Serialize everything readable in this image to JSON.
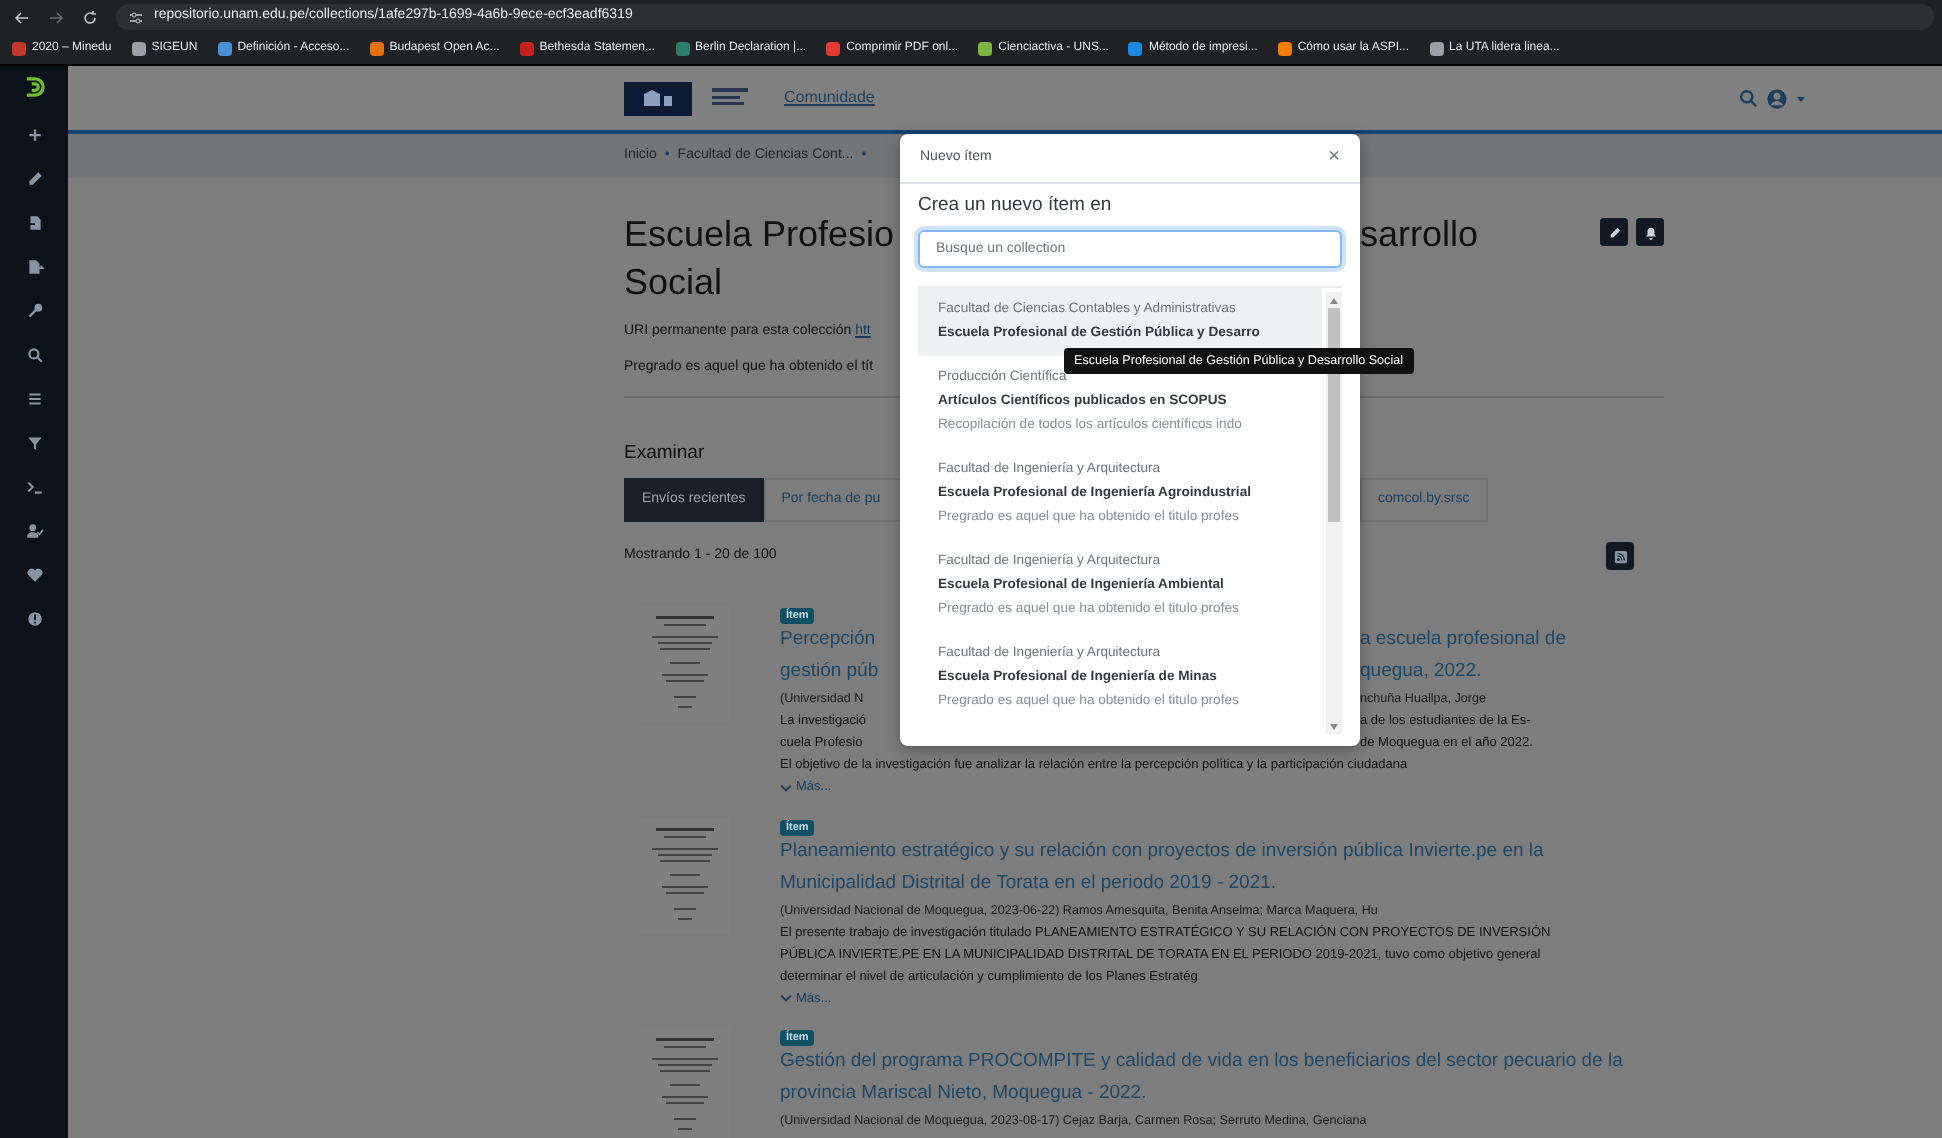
{
  "browser": {
    "url": "repositorio.unam.edu.pe/collections/1afe297b-1699-4a6b-9ece-ecf3eadf6319",
    "bookmarks": [
      {
        "label": "2020 – Minedu",
        "color": "#c0392b"
      },
      {
        "label": "SIGEUN",
        "color": "#9aa0a6"
      },
      {
        "label": "Definición - Acceso...",
        "color": "#4a90d9"
      },
      {
        "label": "Budapest Open Ac...",
        "color": "#e8710a"
      },
      {
        "label": "Bethesda Statemen...",
        "color": "#c5221f"
      },
      {
        "label": "Berlin Declaration |...",
        "color": "#2e7d6b"
      },
      {
        "label": "Comprimir PDF onl...",
        "color": "#e53935"
      },
      {
        "label": "Cienciactiva - UNS...",
        "color": "#7cb342"
      },
      {
        "label": "Método de impresi...",
        "color": "#1e88e5"
      },
      {
        "label": "Cómo usar la ASPI...",
        "color": "#f57c00"
      },
      {
        "label": "La UTA lidera linea...",
        "color": "#9aa0a6"
      }
    ]
  },
  "header": {
    "nav": [
      "Comunidade"
    ]
  },
  "breadcrumb": [
    {
      "kind": "link",
      "text": "Inicio"
    },
    {
      "kind": "separator",
      "text": "•"
    },
    {
      "kind": "link",
      "text": "Facultad de Ciencias Cont..."
    },
    {
      "kind": "separator",
      "text": "•"
    }
  ],
  "collection": {
    "title_left": "Escuela Profesio",
    "title_right": "sarrollo",
    "title_line2": "Social",
    "uri_label": "URI permanente para esta colección",
    "uri_link": "htt",
    "description": "Pregrado es aquel que ha obtenido el tít"
  },
  "browse": {
    "heading": "Examinar",
    "tabs": [
      {
        "label": "Envíos recientes",
        "selected": true
      },
      {
        "label": "Por fecha de pu",
        "selected": false
      },
      {
        "label": "comcol.by.srsc",
        "selected": false
      }
    ]
  },
  "results": {
    "summary": "Mostrando 1 - 20 de 100",
    "items": [
      {
        "badge": "Ítem",
        "lines": [
          {
            "kind": "title",
            "left": "Percepción",
            "right": "a escuela profesional de"
          },
          {
            "kind": "title",
            "left": "gestión púb",
            "right": "quegua, 2022."
          },
          {
            "kind": "meta",
            "left": "(Universidad N",
            "right": "nchuña Huallpa, Jorge"
          },
          {
            "kind": "abstract",
            "left": "La investigació",
            "right": "a de los estudiantes de la Es-"
          },
          {
            "kind": "abstract",
            "left": "cuela Profesio",
            "right": "de Moquegua en el año 2022."
          },
          {
            "kind": "abstract",
            "left": "El objetivo de la investigación fue analizar la relación entre la percepción política y la participación ciudadana"
          }
        ],
        "more": "Más..."
      },
      {
        "badge": "Ítem",
        "title": "Planeamiento estratégico y su relación con proyectos de inversión pública Invierte.pe en la Municipalidad Distrital de Torata en el periodo 2019 - 2021.",
        "meta": "(Universidad Nacional de Moquegua, 2023-06-22) Ramos Amesquita, Benita Anselma; Marca Maquera, Hu",
        "abstract": "El presente trabajo de investigación titulado PLANEAMIENTO ESTRATÉGICO Y SU RELACIÓN CON PROYECTOS DE INVERSIÓN PÚBLICA INVIERTE.PE EN LA MUNICIPALIDAD DISTRITAL DE TORATA EN EL PERIODO 2019-2021, tuvo como objetivo general determinar el nivel de articulación y cumplimiento de los Planes Estratég",
        "more": "Más..."
      },
      {
        "badge": "Ítem",
        "title": "Gestión del programa PROCOMPITE y calidad de vida en los beneficiarios del sector pecuario de la provincia Mariscal Nieto, Moquegua - 2022.",
        "meta": "(Universidad Nacional de Moquegua, 2023-08-17) Cejaz Barja, Carmen Rosa; Serruto Medina, Genciana"
      }
    ]
  },
  "modal": {
    "title": "Nuevo ítem",
    "close": "×",
    "heading": "Crea un nuevo ítem en",
    "placeholder": "Busque un collection",
    "options": [
      {
        "parent": "Facultad de Ciencias Contables y Administrativas",
        "name": "Escuela Profesional de Gestión Pública y Desarro",
        "selected": true
      },
      {
        "parent": "Producción Científica",
        "name": "Artículos Científicos publicados en SCOPUS",
        "description": "Recopilación de todos los artículos científicos indo",
        "selected": false
      },
      {
        "parent": "Facultad de Ingeniería y Arquitectura",
        "name": "Escuela Profesional de Ingeniería Agroindustrial",
        "description": "Pregrado es aquel que ha obtenido el titulo profes",
        "selected": false
      },
      {
        "parent": "Facultad de Ingeniería y Arquitectura",
        "name": "Escuela Profesional de Ingeniería Ambiental",
        "description": "Pregrado es aquel que ha obtenido el titulo profes",
        "selected": false
      },
      {
        "parent": "Facultad de Ingeniería y Arquitectura",
        "name": "Escuela Profesional de Ingeniería de Minas",
        "description": "Pregrado es aquel que ha obtenido el titulo profes",
        "selected": false
      }
    ],
    "tooltip": "Escuela Profesional de Gestión Pública y Desarrollo Social"
  }
}
